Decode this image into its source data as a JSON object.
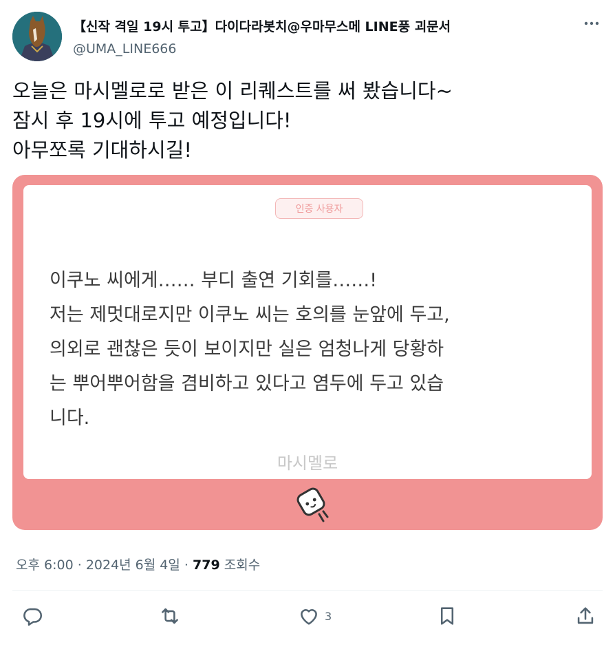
{
  "header": {
    "display_name": "【신작 격일 19시 투고】다이다라봇치@우마무스메 LINE풍 괴문서",
    "handle": "@UMA_LINE666"
  },
  "tweet": {
    "lines": [
      "오늘은 마시멜로로 받은 이 리퀘스트를 써 봤습니다~",
      "잠시 후 19시에 투고 예정입니다!",
      "아무쪼록 기대하시길!"
    ]
  },
  "card": {
    "badge": "인증 사용자",
    "question_lines": [
      "이쿠노 씨에게…… 부디 출연 기회를……!",
      "저는 제멋대로지만 이쿠노 씨는 호의를 눈앞에 두고,",
      "의외로 괜찮은 듯이 보이지만 실은 엄청나게 당황하",
      "는 뿌어뿌어함을 겸비하고 있다고 염두에 두고 있습",
      "니다."
    ],
    "brand": "마시멜로",
    "colors": {
      "frame": "#f19393",
      "badge_text": "#ef9a9a"
    }
  },
  "meta": {
    "time": "오후 6:00",
    "date": "2024년 6월 4일",
    "sep": "·",
    "views_count": "779",
    "views_label": "조회수"
  },
  "actions": {
    "reply_icon": "reply-icon",
    "retweet_icon": "retweet-icon",
    "like_icon": "heart-icon",
    "like_count": "3",
    "bookmark_icon": "bookmark-icon",
    "share_icon": "share-icon"
  }
}
